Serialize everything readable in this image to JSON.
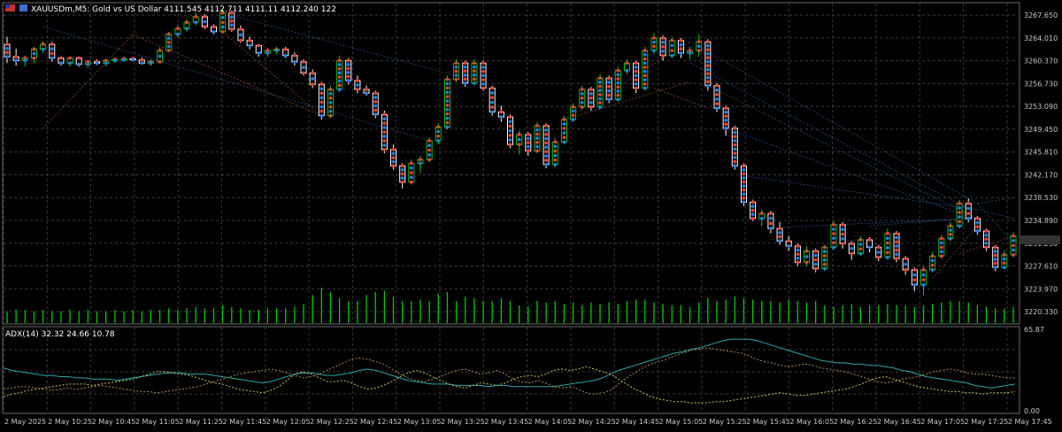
{
  "header": {
    "symbol_line": "XAUUSDm,M5:  Gold vs US Dollar  4111.545 4112.711 4111.11 4112.240  122"
  },
  "indicator": {
    "label": "ADX(14) 32.32 24.66 10.78",
    "scale_top": "65.87",
    "scale_bottom": "0.00"
  },
  "colors": {
    "background": "#000000",
    "grid": "#3a3a3a",
    "bull_candle": "#00c800",
    "bear_candle": "#ffffff",
    "volume": "#00c800",
    "adx_line": "#2aa7a7",
    "di_plus": "#c8c85a",
    "di_minus": "#b08a5a",
    "blue_marker": "#2a7be0",
    "red_marker": "#e8403a"
  },
  "chart_data": [
    {
      "type": "candlestick",
      "y_tick_labels": [
        "3267.650",
        "3264.010",
        "3260.370",
        "3256.730",
        "3253.090",
        "3249.450",
        "3245.810",
        "3242.170",
        "3238.530",
        "3234.890",
        "3231.250",
        "3227.610",
        "3223.970",
        "3220.330"
      ],
      "x_tick_labels": [
        "2 May 2025",
        "2 May 10:25",
        "2 May 10:45",
        "2 May 11:05",
        "2 May 11:25",
        "2 May 11:45",
        "2 May 12:05",
        "2 May 12:25",
        "2 May 12:45",
        "2 May 13:05",
        "2 May 13:25",
        "2 May 13:45",
        "2 May 14:05",
        "2 May 14:25",
        "2 May 14:45",
        "2 May 15:05",
        "2 May 15:25",
        "2 May 15:45",
        "2 May 16:05",
        "2 May 16:25",
        "2 May 16:45",
        "2 May 17:05",
        "2 May 17:25",
        "2 May 17:45"
      ],
      "ylim": [
        3218.5,
        3269.5
      ],
      "candles": [
        [
          3263.0,
          3264.2,
          3260.0,
          3261.0
        ],
        [
          3261.0,
          3262.3,
          3259.6,
          3260.4
        ],
        [
          3260.4,
          3261.2,
          3259.5,
          3260.8
        ],
        [
          3260.8,
          3262.6,
          3260.0,
          3262.2
        ],
        [
          3262.2,
          3263.5,
          3261.6,
          3263.0
        ],
        [
          3263.0,
          3263.4,
          3260.2,
          3260.8
        ],
        [
          3260.8,
          3261.1,
          3259.6,
          3260.0
        ],
        [
          3260.0,
          3261.0,
          3259.5,
          3260.8
        ],
        [
          3260.8,
          3261.0,
          3259.4,
          3259.8
        ],
        [
          3259.8,
          3260.5,
          3259.2,
          3260.2
        ],
        [
          3260.2,
          3260.6,
          3259.7,
          3260.0
        ],
        [
          3260.0,
          3260.6,
          3259.5,
          3260.4
        ],
        [
          3260.4,
          3260.8,
          3260.0,
          3260.6
        ],
        [
          3260.6,
          3261.0,
          3260.2,
          3260.7
        ],
        [
          3260.7,
          3261.0,
          3260.3,
          3260.5
        ],
        [
          3260.5,
          3260.9,
          3259.8,
          3260.0
        ],
        [
          3260.0,
          3260.6,
          3259.6,
          3260.2
        ],
        [
          3260.2,
          3262.5,
          3260.0,
          3262.0
        ],
        [
          3262.0,
          3265.0,
          3261.8,
          3264.6
        ],
        [
          3264.6,
          3266.0,
          3264.0,
          3265.5
        ],
        [
          3265.5,
          3267.0,
          3265.0,
          3266.5
        ],
        [
          3266.5,
          3268.0,
          3266.0,
          3267.4
        ],
        [
          3267.4,
          3267.8,
          3265.4,
          3265.8
        ],
        [
          3265.8,
          3266.2,
          3264.6,
          3265.0
        ],
        [
          3265.0,
          3268.6,
          3264.8,
          3268.0
        ],
        [
          3268.0,
          3268.4,
          3265.0,
          3265.4
        ],
        [
          3265.4,
          3266.0,
          3263.2,
          3263.6
        ],
        [
          3263.6,
          3264.2,
          3262.2,
          3262.8
        ],
        [
          3262.8,
          3263.0,
          3261.0,
          3261.6
        ],
        [
          3261.6,
          3262.4,
          3261.0,
          3262.0
        ],
        [
          3262.0,
          3262.6,
          3261.4,
          3262.2
        ],
        [
          3262.2,
          3262.6,
          3260.8,
          3261.2
        ],
        [
          3261.2,
          3261.7,
          3259.6,
          3260.2
        ],
        [
          3260.2,
          3260.6,
          3258.0,
          3258.4
        ],
        [
          3258.4,
          3259.0,
          3256.0,
          3256.6
        ],
        [
          3256.6,
          3257.0,
          3251.0,
          3251.6
        ],
        [
          3251.6,
          3256.4,
          3251.2,
          3255.8
        ],
        [
          3255.8,
          3261.2,
          3255.4,
          3260.4
        ],
        [
          3260.4,
          3260.8,
          3256.6,
          3257.2
        ],
        [
          3257.2,
          3258.0,
          3255.2,
          3255.8
        ],
        [
          3255.8,
          3256.4,
          3254.8,
          3255.2
        ],
        [
          3255.2,
          3255.6,
          3251.2,
          3251.8
        ],
        [
          3251.8,
          3252.4,
          3245.6,
          3246.2
        ],
        [
          3246.2,
          3247.0,
          3243.0,
          3243.6
        ],
        [
          3243.6,
          3244.0,
          3240.0,
          3241.0
        ],
        [
          3241.0,
          3244.6,
          3240.6,
          3244.0
        ],
        [
          3244.0,
          3245.2,
          3242.4,
          3244.6
        ],
        [
          3244.6,
          3248.2,
          3244.2,
          3247.6
        ],
        [
          3247.6,
          3250.4,
          3247.0,
          3249.8
        ],
        [
          3249.8,
          3258.0,
          3249.4,
          3257.4
        ],
        [
          3257.4,
          3260.6,
          3257.0,
          3260.0
        ],
        [
          3260.0,
          3260.4,
          3256.2,
          3256.8
        ],
        [
          3256.8,
          3260.6,
          3256.4,
          3260.0
        ],
        [
          3260.0,
          3260.4,
          3255.6,
          3256.0
        ],
        [
          3256.0,
          3256.4,
          3251.6,
          3252.2
        ],
        [
          3252.2,
          3253.2,
          3250.6,
          3251.4
        ],
        [
          3251.4,
          3251.8,
          3246.4,
          3247.0
        ],
        [
          3247.0,
          3249.2,
          3245.4,
          3248.6
        ],
        [
          3248.6,
          3249.0,
          3245.2,
          3246.0
        ],
        [
          3246.0,
          3250.6,
          3245.6,
          3250.0
        ],
        [
          3250.0,
          3250.4,
          3243.2,
          3243.8
        ],
        [
          3243.8,
          3248.0,
          3243.4,
          3247.4
        ],
        [
          3247.4,
          3251.6,
          3247.0,
          3251.0
        ],
        [
          3251.0,
          3253.6,
          3250.6,
          3253.0
        ],
        [
          3253.0,
          3256.4,
          3252.6,
          3255.8
        ],
        [
          3255.8,
          3256.2,
          3252.4,
          3253.0
        ],
        [
          3253.0,
          3258.2,
          3252.6,
          3257.6
        ],
        [
          3257.6,
          3258.0,
          3253.6,
          3254.2
        ],
        [
          3254.2,
          3259.4,
          3253.8,
          3258.8
        ],
        [
          3258.8,
          3260.6,
          3258.2,
          3260.0
        ],
        [
          3260.0,
          3260.4,
          3255.2,
          3256.0
        ],
        [
          3256.0,
          3262.6,
          3255.6,
          3262.0
        ],
        [
          3262.0,
          3264.8,
          3261.4,
          3264.0
        ],
        [
          3264.0,
          3264.4,
          3260.4,
          3261.2
        ],
        [
          3261.2,
          3264.2,
          3260.8,
          3263.6
        ],
        [
          3263.6,
          3264.0,
          3260.8,
          3261.6
        ],
        [
          3261.6,
          3262.6,
          3260.6,
          3262.0
        ],
        [
          3262.0,
          3264.6,
          3261.0,
          3263.4
        ],
        [
          3263.4,
          3263.8,
          3255.6,
          3256.4
        ],
        [
          3256.4,
          3256.8,
          3252.2,
          3252.8
        ],
        [
          3252.8,
          3253.2,
          3248.4,
          3249.6
        ],
        [
          3249.6,
          3250.0,
          3243.0,
          3243.6
        ],
        [
          3243.6,
          3244.0,
          3237.2,
          3237.8
        ],
        [
          3237.8,
          3238.2,
          3234.8,
          3235.2
        ],
        [
          3235.2,
          3236.6,
          3234.0,
          3236.0
        ],
        [
          3236.0,
          3236.4,
          3232.8,
          3233.6
        ],
        [
          3233.6,
          3234.6,
          3231.0,
          3231.6
        ],
        [
          3231.6,
          3232.4,
          3230.0,
          3230.8
        ],
        [
          3230.8,
          3231.2,
          3227.6,
          3228.2
        ],
        [
          3228.2,
          3230.8,
          3227.6,
          3230.0
        ],
        [
          3230.0,
          3230.4,
          3226.6,
          3227.2
        ],
        [
          3227.2,
          3231.0,
          3226.8,
          3230.6
        ],
        [
          3230.6,
          3234.8,
          3230.2,
          3234.2
        ],
        [
          3234.2,
          3234.6,
          3230.4,
          3231.2
        ],
        [
          3231.2,
          3231.6,
          3228.6,
          3229.6
        ],
        [
          3229.6,
          3232.4,
          3229.2,
          3231.8
        ],
        [
          3231.8,
          3232.2,
          3229.8,
          3230.6
        ],
        [
          3230.6,
          3231.0,
          3228.4,
          3229.0
        ],
        [
          3229.0,
          3233.6,
          3228.6,
          3232.8
        ],
        [
          3232.8,
          3233.2,
          3228.2,
          3228.8
        ],
        [
          3228.8,
          3229.2,
          3226.2,
          3227.0
        ],
        [
          3227.0,
          3227.4,
          3223.6,
          3224.6
        ],
        [
          3224.6,
          3227.6,
          3223.0,
          3227.0
        ],
        [
          3227.0,
          3229.8,
          3226.6,
          3229.2
        ],
        [
          3229.2,
          3232.6,
          3228.8,
          3232.0
        ],
        [
          3232.0,
          3234.6,
          3231.6,
          3234.0
        ],
        [
          3234.0,
          3238.2,
          3233.6,
          3237.6
        ],
        [
          3237.6,
          3238.4,
          3234.6,
          3235.2
        ],
        [
          3235.2,
          3235.6,
          3232.6,
          3233.2
        ],
        [
          3233.2,
          3233.6,
          3230.0,
          3230.6
        ],
        [
          3230.6,
          3231.0,
          3226.8,
          3227.4
        ],
        [
          3227.4,
          3230.0,
          3227.0,
          3229.4
        ],
        [
          3229.4,
          3233.0,
          3229.0,
          3232.4
        ]
      ]
    },
    {
      "type": "bar",
      "series_name": "volume",
      "values": [
        8,
        9,
        9,
        8,
        9,
        8,
        8,
        9,
        8,
        9,
        8,
        8,
        9,
        8,
        9,
        8,
        9,
        9,
        10,
        9,
        10,
        11,
        10,
        10,
        12,
        11,
        10,
        9,
        9,
        9,
        10,
        10,
        10,
        11,
        13,
        19,
        24,
        21,
        17,
        15,
        15,
        19,
        21,
        22,
        18,
        15,
        15,
        16,
        15,
        20,
        21,
        15,
        18,
        17,
        15,
        15,
        17,
        15,
        12,
        11,
        15,
        14,
        15,
        13,
        14,
        12,
        14,
        13,
        14,
        13,
        15,
        16,
        16,
        14,
        13,
        12,
        12,
        11,
        14,
        17,
        15,
        16,
        18,
        17,
        16,
        15,
        14,
        15,
        14,
        16,
        15,
        14,
        15,
        12,
        11,
        12,
        13,
        11,
        12,
        12,
        13,
        12,
        12,
        11,
        12,
        13,
        14,
        15,
        15,
        14,
        12,
        11,
        10,
        10,
        11
      ]
    },
    {
      "type": "line",
      "series_name_label": "ADX(14) 32.32 24.66 10.78",
      "ylim": [
        0,
        65.87
      ],
      "series": [
        {
          "key": "adx",
          "values": [
            35,
            33,
            32,
            31,
            30,
            29,
            29,
            28,
            28,
            27,
            27,
            26,
            26,
            26,
            25,
            26,
            27,
            28,
            29,
            30,
            31,
            31,
            31,
            30,
            30,
            30,
            29,
            28,
            27,
            26,
            25,
            24,
            23,
            24,
            26,
            28,
            30,
            31,
            31,
            30,
            29,
            29,
            30,
            31,
            33,
            34,
            33,
            31,
            29,
            27,
            25,
            24,
            23,
            22,
            22,
            22,
            21,
            21,
            21,
            21,
            20,
            21,
            21,
            20,
            20,
            20,
            20,
            20,
            20,
            21,
            22,
            23,
            24,
            25,
            27,
            30,
            33,
            35,
            37,
            39,
            41,
            43,
            45,
            47,
            48,
            50,
            51,
            53,
            55,
            57,
            58,
            58,
            58,
            57,
            55,
            53,
            51,
            49,
            47,
            45,
            43,
            41,
            40,
            39,
            39,
            38,
            38,
            37,
            37,
            36,
            35,
            33,
            32,
            30,
            28,
            27,
            26,
            25,
            24,
            23,
            21,
            20,
            19,
            20,
            21,
            22
          ]
        },
        {
          "key": "di_plus",
          "values": [
            12,
            14,
            15,
            17,
            18,
            19,
            20,
            21,
            22,
            22,
            22,
            21,
            22,
            23,
            24,
            25,
            26,
            28,
            30,
            32,
            32,
            31,
            30,
            29,
            27,
            25,
            23,
            22,
            20,
            18,
            17,
            16,
            15,
            17,
            20,
            25,
            30,
            32,
            30,
            27,
            24,
            24,
            25,
            23,
            20,
            18,
            19,
            21,
            24,
            28,
            31,
            33,
            31,
            28,
            25,
            22,
            20,
            19,
            21,
            23,
            22,
            21,
            23,
            26,
            28,
            29,
            28,
            30,
            33,
            34,
            33,
            34,
            36,
            34,
            32,
            30,
            26,
            22,
            18,
            15,
            12,
            10,
            9,
            8,
            8,
            7,
            7,
            7,
            8,
            8,
            9,
            10,
            11,
            12,
            13,
            14,
            15,
            14,
            13,
            13,
            14,
            15,
            16,
            17,
            18,
            20,
            22,
            25,
            27,
            28,
            26,
            24,
            22,
            20,
            19,
            18,
            17,
            16,
            16,
            15,
            15,
            14,
            15,
            15,
            15,
            16
          ]
        },
        {
          "key": "di_minus",
          "values": [
            18,
            19,
            20,
            20,
            19,
            18,
            17,
            18,
            19,
            18,
            19,
            20,
            21,
            20,
            19,
            18,
            17,
            16,
            16,
            15,
            16,
            17,
            18,
            19,
            20,
            22,
            24,
            26,
            28,
            30,
            31,
            32,
            33,
            34,
            33,
            31,
            29,
            27,
            28,
            30,
            33,
            36,
            39,
            42,
            43,
            42,
            40,
            38,
            34,
            30,
            27,
            25,
            24,
            26,
            28,
            31,
            33,
            34,
            32,
            30,
            31,
            33,
            30,
            26,
            24,
            23,
            25,
            23,
            20,
            19,
            20,
            18,
            15,
            14,
            15,
            17,
            22,
            27,
            31,
            35,
            38,
            40,
            42,
            45,
            47,
            49,
            50,
            51,
            50,
            49,
            48,
            47,
            45,
            42,
            40,
            39,
            37,
            36,
            37,
            38,
            37,
            35,
            34,
            33,
            32,
            30,
            28,
            26,
            24,
            23,
            24,
            26,
            27,
            28,
            30,
            32,
            33,
            34,
            33,
            31,
            30,
            30,
            29,
            28,
            27,
            27
          ]
        }
      ]
    }
  ]
}
